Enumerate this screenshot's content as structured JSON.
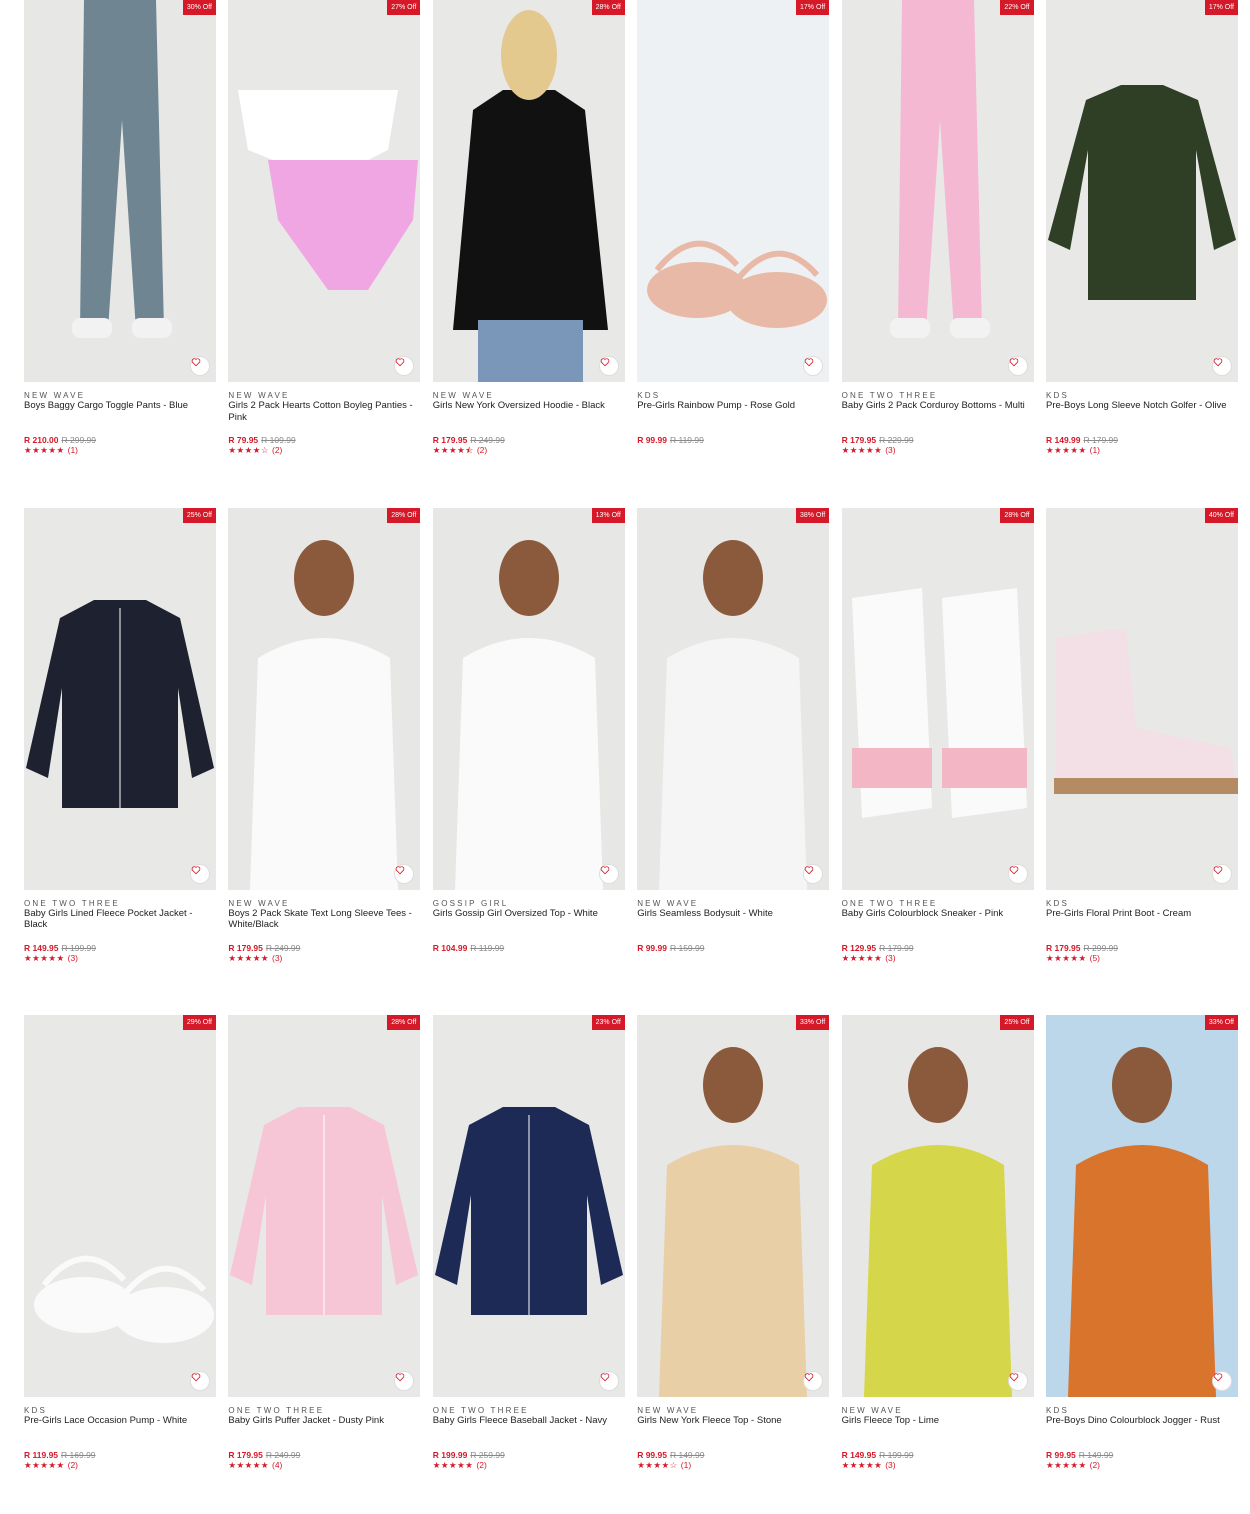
{
  "products": [
    {
      "discount": "30% Off",
      "brand": "NEW WAVE",
      "name": "Boys Baggy Cargo Toggle Pants - Blue",
      "price": "R 210.00",
      "was": "R 299.99",
      "stars": "★★★★★",
      "count": "(1)",
      "color": "#6f8591",
      "bg": "#e7e7e6",
      "shape": "pants"
    },
    {
      "discount": "27% Off",
      "brand": "NEW WAVE",
      "name": "Girls 2 Pack Hearts Cotton Boyleg Panties - Pink",
      "price": "R 79.95",
      "was": "R 109.99",
      "stars": "★★★★☆",
      "count": "(2)",
      "color": "#f0a6e3",
      "bg": "#e8e8e7",
      "shape": "panties"
    },
    {
      "discount": "28% Off",
      "brand": "NEW WAVE",
      "name": "Girls New York Oversized Hoodie - Black",
      "price": "R 179.95",
      "was": "R 249.99",
      "stars": "★★★★⯪",
      "count": "(2)",
      "color": "#111111",
      "bg": "#e8e8e7",
      "shape": "hoodie"
    },
    {
      "discount": "17% Off",
      "brand": "KDS",
      "name": "Pre-Girls Rainbow Pump - Rose Gold",
      "price": "R 99.99",
      "was": "R 119.99",
      "stars": "",
      "count": "",
      "color": "#e8b9a6",
      "bg": "#eef1f3",
      "shape": "shoes"
    },
    {
      "discount": "22% Off",
      "brand": "ONE TWO THREE",
      "name": "Baby Girls 2 Pack Corduroy Bottoms - Multi",
      "price": "R 179.95",
      "was": "R 229.99",
      "stars": "★★★★★",
      "count": "(3)",
      "color": "#f5b8d2",
      "bg": "#e8e8e7",
      "shape": "pants2"
    },
    {
      "discount": "17% Off",
      "brand": "KDS",
      "name": "Pre-Boys Long Sleeve Notch Golfer - Olive",
      "price": "R 149.99",
      "was": "R 179.99",
      "stars": "★★★★★",
      "count": "(1)",
      "color": "#2f3f26",
      "bg": "#e8e8e7",
      "shape": "top"
    },
    {
      "discount": "25% Off",
      "brand": "ONE TWO THREE",
      "name": "Baby Girls Lined Fleece Pocket Jacket - Black",
      "price": "R 149.95",
      "was": "R 199.99",
      "stars": "★★★★★",
      "count": "(3)",
      "color": "#1e2230",
      "bg": "#e8e8e7",
      "shape": "jacket"
    },
    {
      "discount": "28% Off",
      "brand": "NEW WAVE",
      "name": "Boys 2 Pack Skate Text Long Sleeve Tees - White/Black",
      "price": "R 179.95",
      "was": "R 249.99",
      "stars": "★★★★★",
      "count": "(3)",
      "color": "#fafafa",
      "bg": "#e7e7e6",
      "shape": "person"
    },
    {
      "discount": "13% Off",
      "brand": "GOSSIP GIRL",
      "name": "Girls Gossip Girl Oversized Top - White",
      "price": "R 104.99",
      "was": "R 119.99",
      "stars": "",
      "count": "",
      "color": "#fafafa",
      "bg": "#e7e7e6",
      "shape": "person"
    },
    {
      "discount": "38% Off",
      "brand": "NEW WAVE",
      "name": "Girls Seamless Bodysuit - White",
      "price": "R 99.99",
      "was": "R 159.99",
      "stars": "",
      "count": "",
      "color": "#f5f5f5",
      "bg": "#e7e7e6",
      "shape": "person"
    },
    {
      "discount": "28% Off",
      "brand": "ONE TWO THREE",
      "name": "Baby Girls Colourblock Sneaker - Pink",
      "price": "R 129.95",
      "was": "R 179.99",
      "stars": "★★★★★",
      "count": "(3)",
      "color": "#f2b6c4",
      "bg": "#e8e8e7",
      "shape": "sneakers"
    },
    {
      "discount": "40% Off",
      "brand": "KDS",
      "name": "Pre-Girls Floral Print Boot - Cream",
      "price": "R 179.95",
      "was": "R 299.99",
      "stars": "★★★★★",
      "count": "(5)",
      "color": "#f3dfe6",
      "bg": "#e8e8e7",
      "shape": "boot"
    },
    {
      "discount": "29% Off",
      "brand": "KDS",
      "name": "Pre-Girls Lace Occasion Pump - White",
      "price": "R 119.95",
      "was": "R 169.99",
      "stars": "★★★★★",
      "count": "(2)",
      "color": "#fafafa",
      "bg": "#e8e8e7",
      "shape": "shoes"
    },
    {
      "discount": "28% Off",
      "brand": "ONE TWO THREE",
      "name": "Baby Girls Puffer Jacket - Dusty Pink",
      "price": "R 179.95",
      "was": "R 249.99",
      "stars": "★★★★★",
      "count": "(4)",
      "color": "#f7c6d6",
      "bg": "#e8e8e7",
      "shape": "jacket"
    },
    {
      "discount": "23% Off",
      "brand": "ONE TWO THREE",
      "name": "Baby Girls Fleece Baseball Jacket - Navy",
      "price": "R 199.99",
      "was": "R 259.99",
      "stars": "★★★★★",
      "count": "(2)",
      "color": "#1d2a55",
      "bg": "#e8e8e7",
      "shape": "jacket"
    },
    {
      "discount": "33% Off",
      "brand": "NEW WAVE",
      "name": "Girls New York Fleece Top - Stone",
      "price": "R 99.95",
      "was": "R 149.99",
      "stars": "★★★★☆",
      "count": "(1)",
      "color": "#e8cfa6",
      "bg": "#e7e7e6",
      "shape": "person"
    },
    {
      "discount": "25% Off",
      "brand": "NEW WAVE",
      "name": "Girls Fleece Top - Lime",
      "price": "R 149.95",
      "was": "R 199.99",
      "stars": "★★★★★",
      "count": "(3)",
      "color": "#d6d64a",
      "bg": "#e7e7e6",
      "shape": "person"
    },
    {
      "discount": "33% Off",
      "brand": "KDS",
      "name": "Pre-Boys Dino Colourblock Jogger - Rust",
      "price": "R 99.95",
      "was": "R 149.99",
      "stars": "★★★★★",
      "count": "(2)",
      "color": "#d9742c",
      "bg": "#bcd6ea",
      "shape": "person"
    }
  ],
  "theme": {
    "accent": "#d51928"
  },
  "icons": {
    "wishlist": "heart-icon"
  }
}
